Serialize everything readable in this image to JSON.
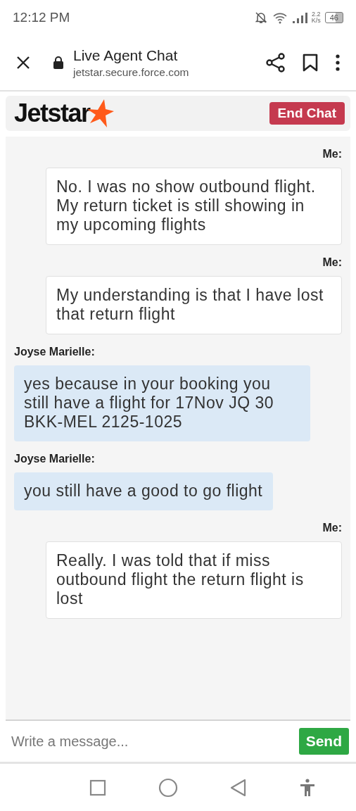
{
  "status_bar": {
    "time": "12:12 PM",
    "speed": "2.2",
    "speed_unit": "K/s",
    "battery": "46"
  },
  "toolbar": {
    "title": "Live Agent Chat",
    "url": "jetstar.secure.force.com"
  },
  "header": {
    "logo": "Jetstar",
    "end_button": "End Chat"
  },
  "messages": [
    {
      "kind": "outgoing",
      "sender": "Me:",
      "text": "No. I was no show outbound flight. My return ticket is still showing in my upcoming flights"
    },
    {
      "kind": "outgoing",
      "sender": "Me:",
      "text": "My understanding is that I have lost that return flight"
    },
    {
      "kind": "incoming",
      "sender": "Joyse Marielle:",
      "text": "yes because in your booking you still have a flight for 17Nov JQ 30 BKK-MEL 2125-1025"
    },
    {
      "kind": "incoming",
      "sender": "Joyse Marielle:",
      "text": "you still have a good to go flight"
    },
    {
      "kind": "outgoing",
      "sender": "Me:",
      "text": "Really. I was told that if miss outbound flight the return flight is lost"
    }
  ],
  "composer": {
    "placeholder": "Write a message...",
    "send_button": "Send"
  }
}
